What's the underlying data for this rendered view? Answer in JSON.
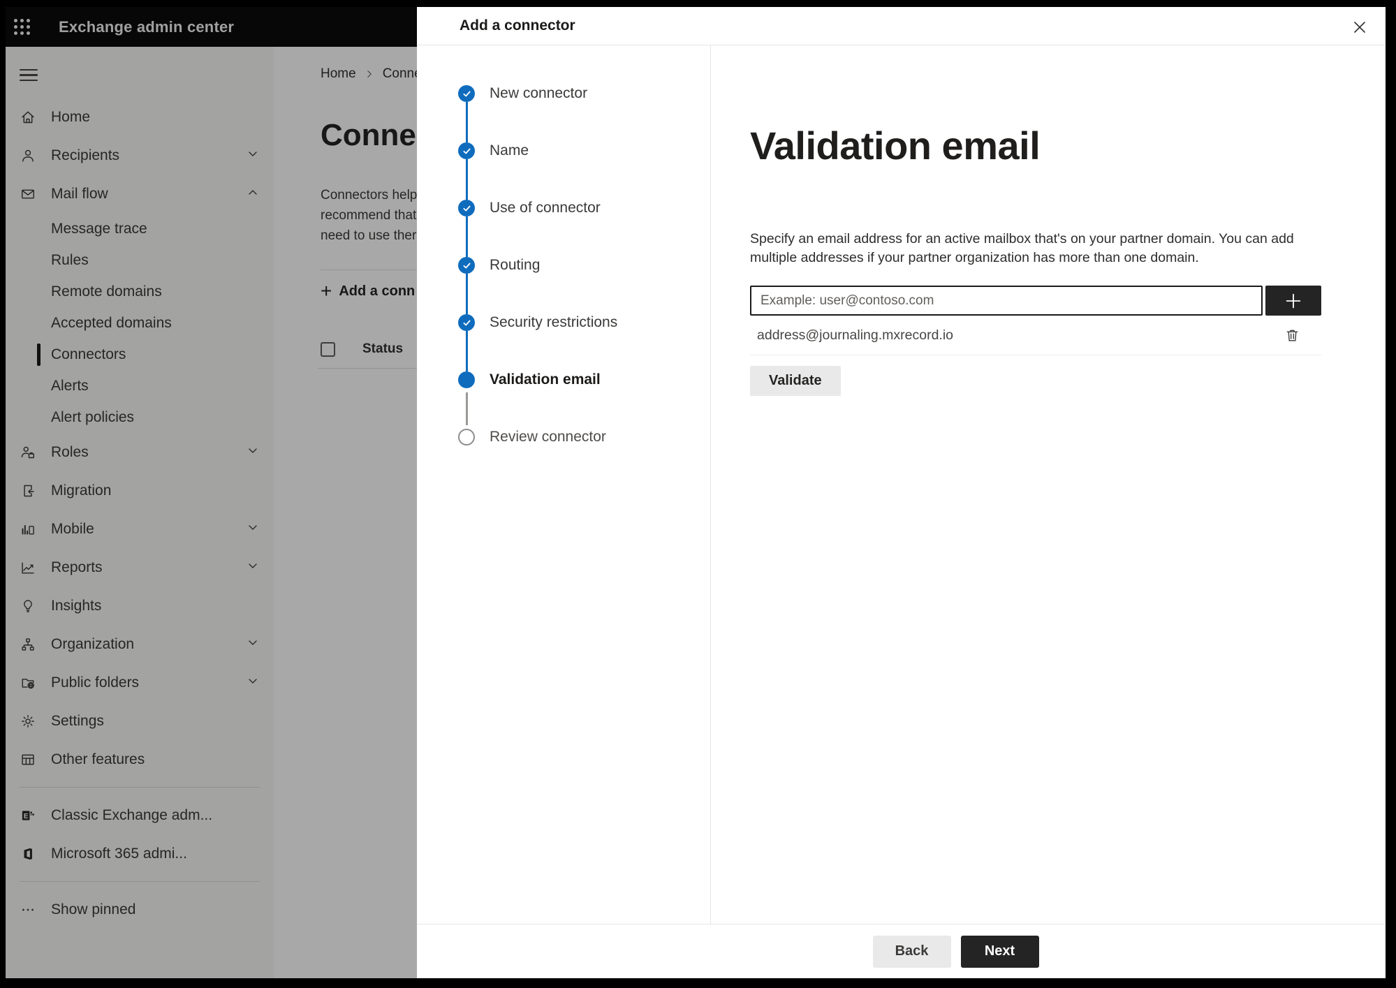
{
  "banner": {
    "app_title": "Exchange admin center"
  },
  "sidebar": {
    "items": [
      {
        "label": "Home",
        "icon": "home-icon"
      },
      {
        "label": "Recipients",
        "icon": "person-icon",
        "chevron": "down"
      },
      {
        "label": "Mail flow",
        "icon": "mail-icon",
        "chevron": "up"
      },
      {
        "label": "Message trace"
      },
      {
        "label": "Rules"
      },
      {
        "label": "Remote domains"
      },
      {
        "label": "Accepted domains"
      },
      {
        "label": "Connectors",
        "selected": true
      },
      {
        "label": "Alerts"
      },
      {
        "label": "Alert policies"
      },
      {
        "label": "Roles",
        "icon": "roles-icon",
        "chevron": "down"
      },
      {
        "label": "Migration",
        "icon": "migration-icon"
      },
      {
        "label": "Mobile",
        "icon": "mobile-icon",
        "chevron": "down"
      },
      {
        "label": "Reports",
        "icon": "reports-icon",
        "chevron": "down"
      },
      {
        "label": "Insights",
        "icon": "insights-icon"
      },
      {
        "label": "Organization",
        "icon": "organization-icon",
        "chevron": "down"
      },
      {
        "label": "Public folders",
        "icon": "public-folders-icon",
        "chevron": "down"
      },
      {
        "label": "Settings",
        "icon": "settings-icon"
      },
      {
        "label": "Other features",
        "icon": "other-features-icon"
      }
    ],
    "footer_items": [
      {
        "label": "Classic Exchange adm...",
        "icon": "classic-exchange-icon"
      },
      {
        "label": "Microsoft 365 admi...",
        "icon": "microsoft-365-icon"
      }
    ],
    "show_pinned": "Show pinned"
  },
  "page": {
    "breadcrumb": [
      "Home",
      "Conne"
    ],
    "title": "Connect",
    "description_lines": [
      "Connectors help",
      "recommend that",
      "need to use ther"
    ],
    "add_button_label": "Add a conn",
    "status_column": "Status"
  },
  "modal": {
    "title": "Add a connector",
    "steps": [
      {
        "label": "New connector",
        "state": "done"
      },
      {
        "label": "Name",
        "state": "done"
      },
      {
        "label": "Use of connector",
        "state": "done"
      },
      {
        "label": "Routing",
        "state": "done"
      },
      {
        "label": "Security restrictions",
        "state": "done"
      },
      {
        "label": "Validation email",
        "state": "current"
      },
      {
        "label": "Review connector",
        "state": "todo"
      }
    ],
    "content": {
      "heading": "Validation email",
      "description_line1": "Specify an email address for an active mailbox that's on your partner domain. You can add",
      "description_line2": "multiple addresses if your partner organization has more than one domain.",
      "input_placeholder": "Example: user@contoso.com",
      "input_value": "",
      "added_address": "address@journaling.mxrecord.io",
      "validate_button": "Validate"
    },
    "footer": {
      "back": "Back",
      "next": "Next"
    }
  },
  "colors": {
    "accent": "#0f6cbd",
    "dark_button": "#242424",
    "banner_bg": "#0b0b0b"
  }
}
